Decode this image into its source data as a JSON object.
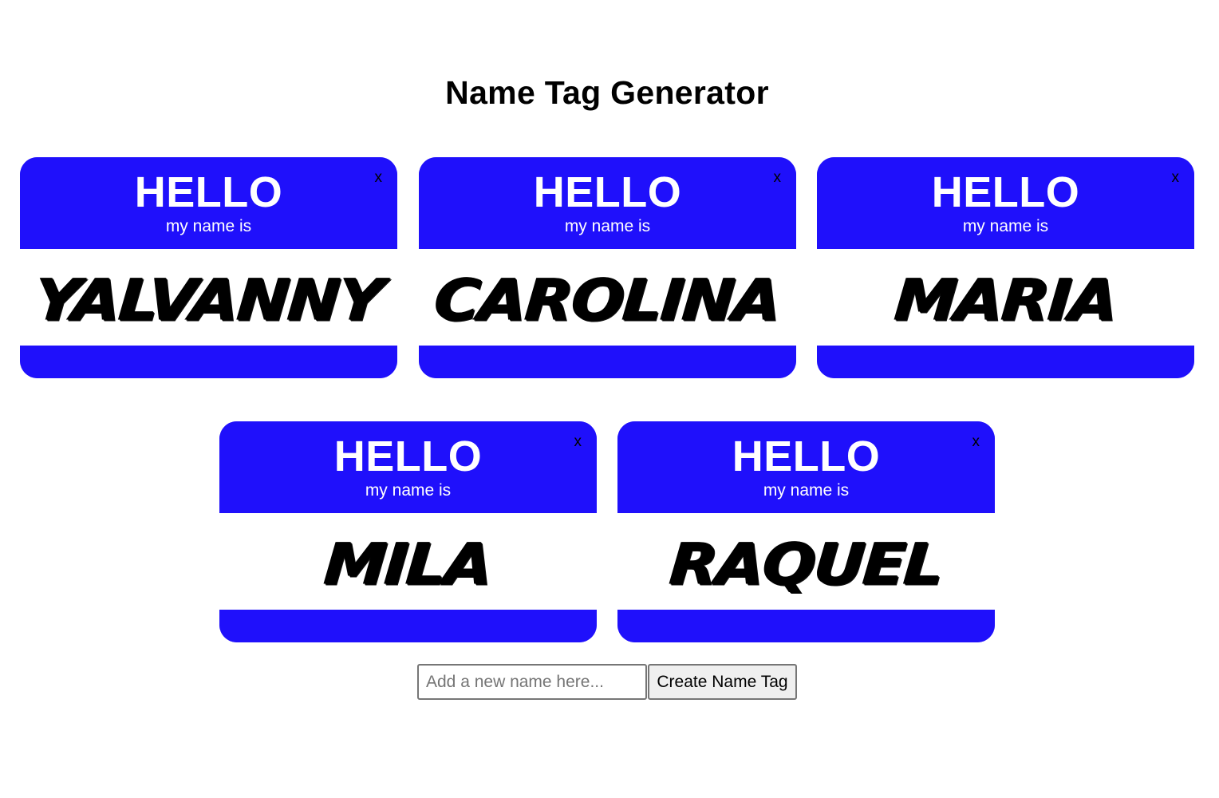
{
  "page": {
    "title": "Name Tag Generator"
  },
  "tags": [
    {
      "hello": "HELLO",
      "subtitle": "my name is",
      "name": "Yalvanny",
      "close": "x"
    },
    {
      "hello": "HELLO",
      "subtitle": "my name is",
      "name": "Carolina",
      "close": "x"
    },
    {
      "hello": "HELLO",
      "subtitle": "my name is",
      "name": "Maria",
      "close": "x"
    },
    {
      "hello": "HELLO",
      "subtitle": "my name is",
      "name": "Mila",
      "close": "x"
    },
    {
      "hello": "HELLO",
      "subtitle": "my name is",
      "name": "Raquel",
      "close": "x"
    }
  ],
  "form": {
    "input_value": "",
    "input_placeholder": "Add a new name here...",
    "button_label": "Create Name Tag"
  },
  "colors": {
    "tag_blue": "#1f10fb",
    "background": "#ffffff",
    "text": "#000000"
  }
}
